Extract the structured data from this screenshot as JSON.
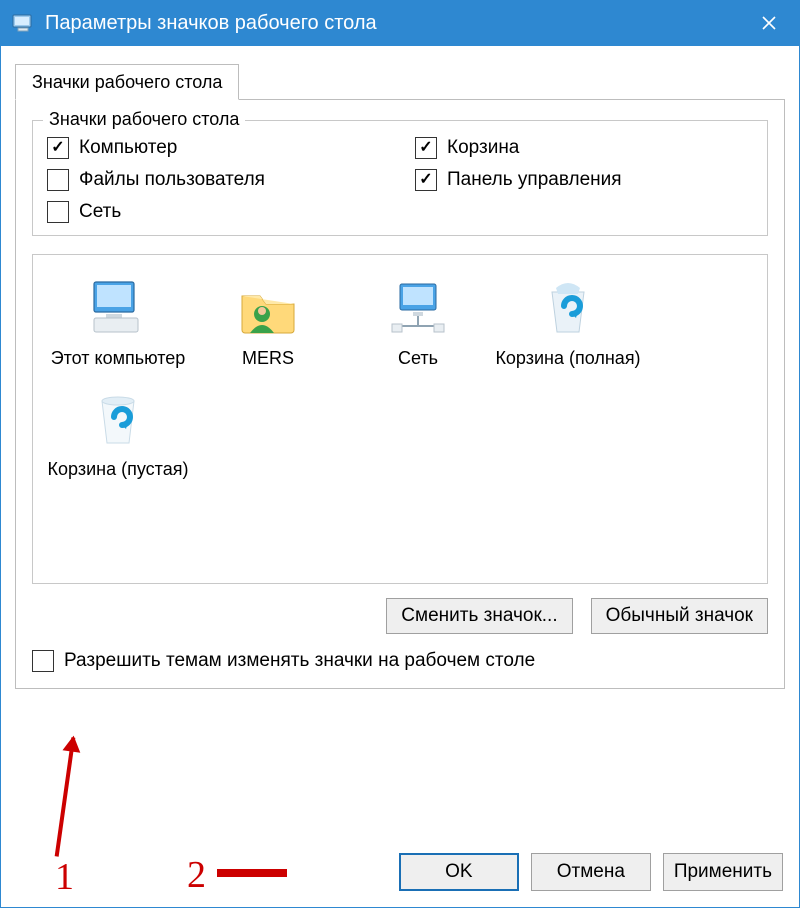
{
  "titlebar": {
    "title": "Параметры значков рабочего стола"
  },
  "tab": {
    "label": "Значки рабочего стола"
  },
  "group": {
    "legend": "Значки рабочего стола",
    "items": [
      {
        "label": "Компьютер",
        "checked": true
      },
      {
        "label": "Корзина",
        "checked": true
      },
      {
        "label": "Файлы пользователя",
        "checked": false
      },
      {
        "label": "Панель управления",
        "checked": true
      },
      {
        "label": "Сеть",
        "checked": false
      }
    ]
  },
  "icons": [
    {
      "label": "Этот компьютер",
      "kind": "computer"
    },
    {
      "label": "MERS",
      "kind": "userfolder"
    },
    {
      "label": "Сеть",
      "kind": "network"
    },
    {
      "label": "Корзина (полная)",
      "kind": "recycle-full"
    },
    {
      "label": "Корзина (пустая)",
      "kind": "recycle-empty"
    }
  ],
  "buttons": {
    "change_icon": "Сменить значок...",
    "default_icon": "Обычный значок"
  },
  "allow_themes": {
    "label": "Разрешить темам изменять значки на рабочем столе",
    "checked": false
  },
  "dialog": {
    "ok": "OK",
    "cancel": "Отмена",
    "apply": "Применить"
  },
  "annotations": {
    "one": "1",
    "two": "2"
  }
}
